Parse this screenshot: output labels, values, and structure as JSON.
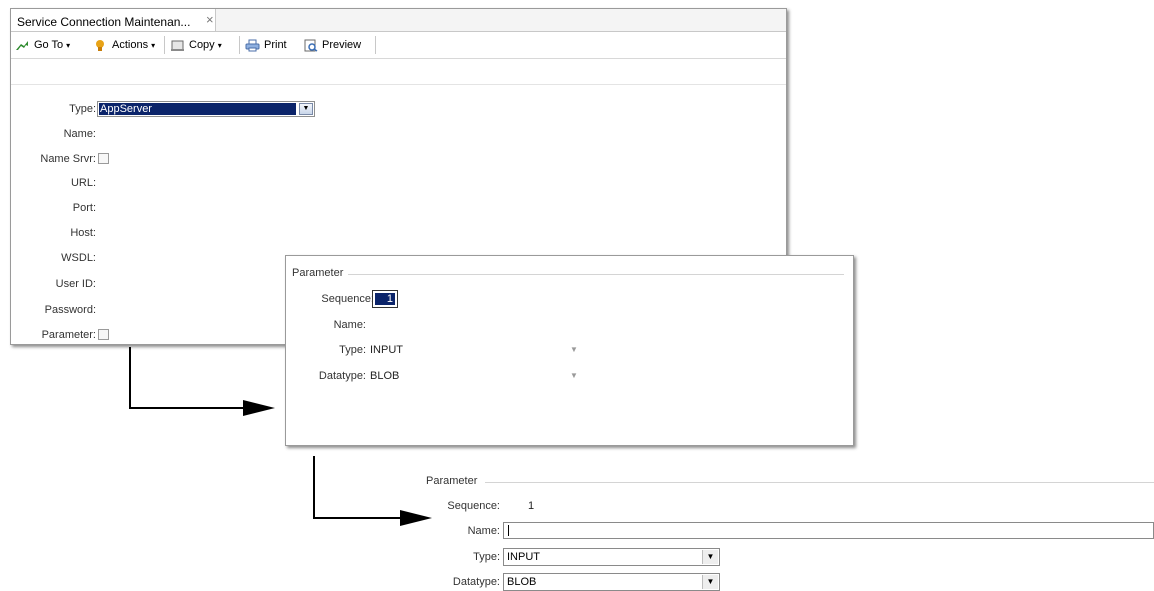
{
  "window1": {
    "tab_title": "Service Connection Maintenan...",
    "close_glyph": "×",
    "toolbar": {
      "goto_label": "Go To",
      "actions_label": "Actions",
      "copy_label": "Copy",
      "print_label": "Print",
      "preview_label": "Preview",
      "caret": "▾"
    },
    "fields": {
      "type_label": "Type:",
      "type_value": "AppServer",
      "name_label": "Name:",
      "name_srvr_label": "Name Srvr:",
      "url_label": "URL:",
      "port_label": "Port:",
      "host_label": "Host:",
      "wsdl_label": "WSDL:",
      "userid_label": "User ID:",
      "password_label": "Password:",
      "parameter_label": "Parameter:"
    }
  },
  "window2": {
    "group_title": "Parameter",
    "sequence_label": "Sequence:",
    "sequence_value": "1",
    "name_label": "Name:",
    "type_label": "Type:",
    "type_value": "INPUT",
    "datatype_label": "Datatype:",
    "datatype_value": "BLOB"
  },
  "panel3": {
    "group_title": "Parameter",
    "sequence_label": "Sequence:",
    "sequence_value": "1",
    "name_label": "Name:",
    "name_value": "",
    "type_label": "Type:",
    "type_value": "INPUT",
    "datatype_label": "Datatype:",
    "datatype_value": "BLOB"
  },
  "dropdown_glyph": "▼",
  "colors": {
    "selection_bg": "#0b246a",
    "goto_icon": "#2e8b2e",
    "actions_icon": "#e8a317"
  }
}
